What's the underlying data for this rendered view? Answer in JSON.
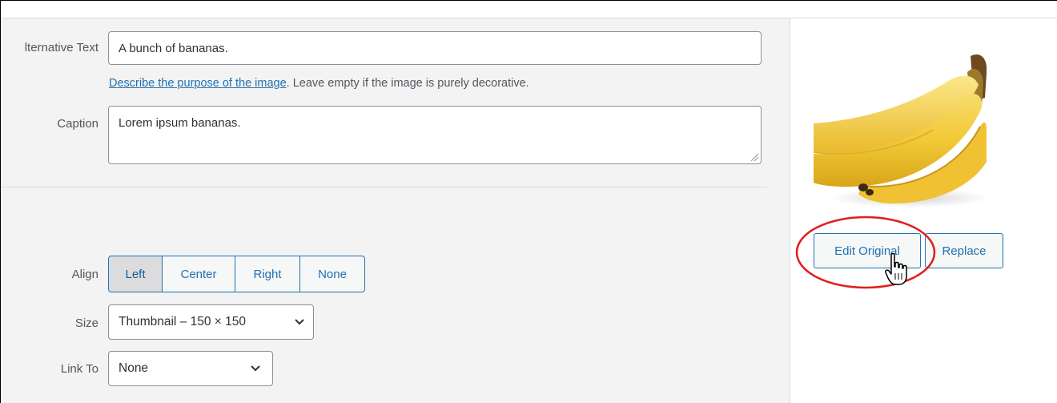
{
  "fields": {
    "alt_text": {
      "label": "lternative Text",
      "value": "A bunch of bananas."
    },
    "alt_help": {
      "link_text": "Describe the purpose of the image",
      "rest_text": ". Leave empty if the image is purely decorative."
    },
    "caption": {
      "label": "Caption",
      "value": "Lorem ipsum bananas."
    }
  },
  "display_settings": {
    "align": {
      "label": "Align",
      "options": [
        "Left",
        "Center",
        "Right",
        "None"
      ],
      "selected": "Left"
    },
    "size": {
      "label": "Size",
      "value": "Thumbnail – 150 × 150"
    },
    "link_to": {
      "label": "Link To",
      "value": "None"
    }
  },
  "image_actions": {
    "edit_original_label": "Edit Original",
    "replace_label": "Replace"
  },
  "colors": {
    "accent": "#2271b1",
    "highlight_ellipse": "#e01e1e",
    "panel_bg": "#f3f3f3"
  },
  "icons": {
    "select_chevron": "chevron-down-icon",
    "textarea_resize": "resize-handle-icon",
    "cursor": "hand-pointer-icon"
  }
}
